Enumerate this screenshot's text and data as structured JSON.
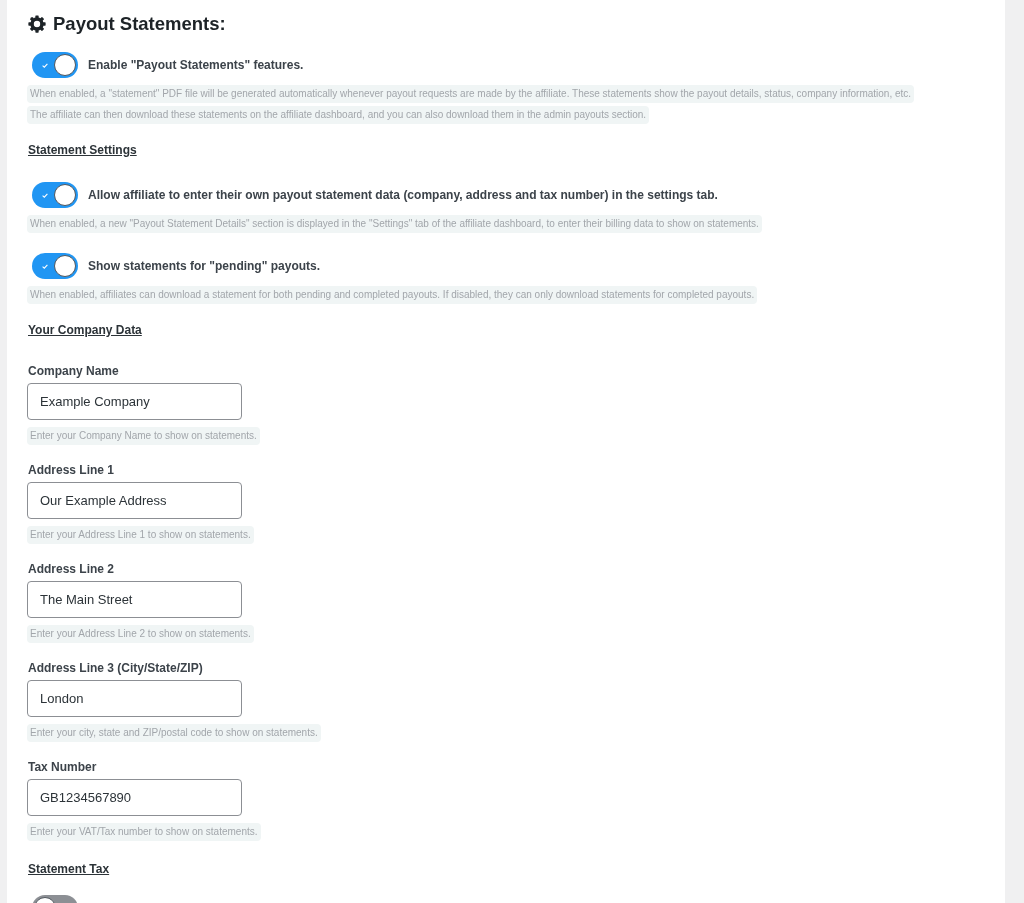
{
  "section": {
    "title": "Payout Statements:"
  },
  "blocks": [
    {
      "kind": "toggle",
      "on": true,
      "label": "Enable \"Payout Statements\" features.",
      "descriptions": [
        "When enabled, a \"statement\" PDF file will be generated automatically whenever payout requests are made by the affiliate. These statements show the payout details, status, company information, etc.",
        "The affiliate can then download these statements on the affiliate dashboard, and you can also download them in the admin payouts section."
      ]
    },
    {
      "kind": "subheading",
      "text": "Statement Settings"
    },
    {
      "kind": "toggle",
      "on": true,
      "label": "Allow affiliate to enter their own payout statement data (company, address and tax number) in the settings tab.",
      "descriptions": [
        "When enabled, a new \"Payout Statement Details\" section is displayed in the \"Settings\" tab of the affiliate dashboard, to enter their billing data to show on statements."
      ]
    },
    {
      "kind": "toggle",
      "on": true,
      "label": "Show statements for \"pending\" payouts.",
      "descriptions": [
        "When enabled, affiliates can download a statement for both pending and completed payouts. If disabled, they can only download statements for completed payouts."
      ]
    },
    {
      "kind": "subheading",
      "text": "Your Company Data"
    },
    {
      "kind": "field",
      "label": "Company Name",
      "value": "Example Company",
      "hint": "Enter your Company Name to show on statements."
    },
    {
      "kind": "field",
      "label": "Address Line 1",
      "value": "Our Example Address",
      "hint": "Enter your Address Line 1 to show on statements."
    },
    {
      "kind": "field",
      "label": "Address Line 2",
      "value": "The Main Street",
      "hint": "Enter your Address Line 2 to show on statements."
    },
    {
      "kind": "field",
      "label": "Address Line 3 (City/State/ZIP)",
      "value": "London",
      "hint": "Enter your city, state and ZIP/postal code to show on statements."
    },
    {
      "kind": "field",
      "label": "Tax Number",
      "value": "GB1234567890",
      "hint": "Enter your VAT/Tax number to show on statements."
    },
    {
      "kind": "subheading",
      "text": "Statement Tax"
    },
    {
      "kind": "toggle",
      "on": false
    }
  ]
}
